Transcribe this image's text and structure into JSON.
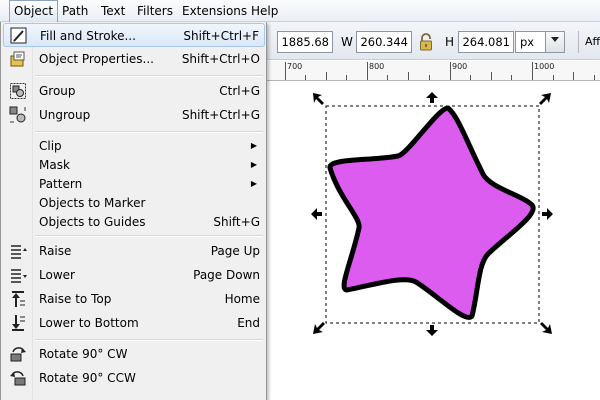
{
  "menubar": {
    "items": [
      {
        "label": "Object",
        "name": "menu-object",
        "active": true
      },
      {
        "label": "Path",
        "name": "menu-path"
      },
      {
        "label": "Text",
        "name": "menu-text"
      },
      {
        "label": "Filters",
        "name": "menu-filters"
      },
      {
        "label": "Extensions",
        "name": "menu-extensions"
      },
      {
        "label": "Help",
        "name": "menu-help"
      }
    ]
  },
  "toolbar": {
    "y_value": "1885.68",
    "w_label": "W",
    "w_value": "260.344",
    "h_label": "H",
    "h_value": "264.081",
    "unit": "px",
    "affect_label": "Aff"
  },
  "ruler": {
    "labels": [
      "700",
      "800",
      "900",
      "1000"
    ]
  },
  "object_menu": {
    "items": [
      {
        "label": "Fill and Stroke...",
        "shortcut": "Shift+Ctrl+F",
        "icon": "fill-stroke-icon",
        "highlighted": true
      },
      {
        "label": "Object Properties...",
        "shortcut": "Shift+Ctrl+O",
        "icon": "object-properties-icon"
      },
      {
        "label": "Group",
        "shortcut": "Ctrl+G",
        "icon": "group-icon"
      },
      {
        "label": "Ungroup",
        "shortcut": "Shift+Ctrl+G",
        "icon": "ungroup-icon"
      },
      {
        "label": "Clip",
        "submenu": true
      },
      {
        "label": "Mask",
        "submenu": true
      },
      {
        "label": "Pattern",
        "submenu": true
      },
      {
        "label": "Objects to Marker",
        "shortcut": ""
      },
      {
        "label": "Objects to Guides",
        "shortcut": "Shift+G"
      },
      {
        "label": "Raise",
        "shortcut": "Page Up",
        "icon": "raise-icon"
      },
      {
        "label": "Lower",
        "shortcut": "Page Down",
        "icon": "lower-icon"
      },
      {
        "label": "Raise to Top",
        "shortcut": "Home",
        "icon": "raise-to-top-icon"
      },
      {
        "label": "Lower to Bottom",
        "shortcut": "End",
        "icon": "lower-to-bottom-icon"
      },
      {
        "label": "Rotate 90° CW",
        "shortcut": "",
        "icon": "rotate-cw-icon"
      },
      {
        "label": "Rotate 90° CCW",
        "shortcut": "",
        "icon": "rotate-ccw-icon"
      }
    ]
  },
  "canvas": {
    "star_fill": "#dd5cf0",
    "star_stroke": "#000000"
  }
}
